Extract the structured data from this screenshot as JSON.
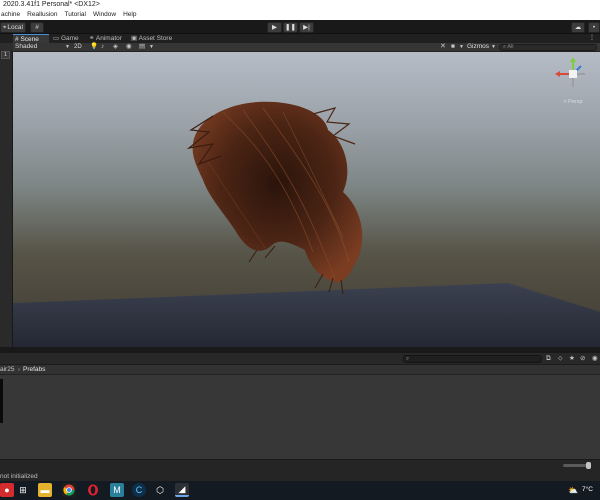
{
  "titlebar": {
    "title": "2020.3.41f1 Personal* <DX12>"
  },
  "menubar": {
    "items": [
      "achine",
      "Reallusion",
      "Tutorial",
      "Window",
      "Help"
    ]
  },
  "toolbar": {
    "local_label": "Local"
  },
  "tabs": [
    {
      "label": "Scene"
    },
    {
      "label": "Game"
    },
    {
      "label": "Animator"
    },
    {
      "label": "Asset Store"
    }
  ],
  "scene_toolbar": {
    "shading": "Shaded",
    "dimension": "2D",
    "gizmos": "Gizmos",
    "search_placeholder": "All"
  },
  "gizmo": {
    "perspective_label": "< Persp"
  },
  "left_strip": {
    "digit": "1"
  },
  "project": {
    "breadcrumb_parent": "air25",
    "breadcrumb_current": "Prefabs"
  },
  "status": {
    "message": "not initialized"
  },
  "taskbar": {
    "temperature": "7°C"
  },
  "colors": {
    "accent": "#4a8fd6",
    "scene_sky": "#b6bcc6",
    "hair": "#5a2f1c"
  }
}
